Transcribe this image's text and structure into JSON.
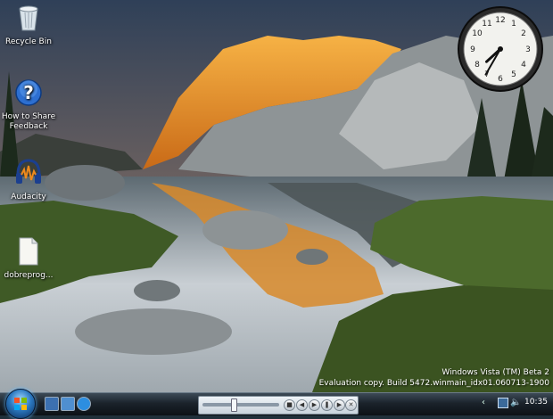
{
  "desktop": {
    "icons": [
      {
        "label": "Recycle Bin"
      },
      {
        "label": "How to Share Feedback"
      },
      {
        "label": "Audacity"
      },
      {
        "label": "dobreprog..."
      }
    ]
  },
  "watermark": {
    "line1": "Windows Vista (TM) Beta 2",
    "line2": "Evaluation copy. Build 5472.winmain_idx01.060713-1900"
  },
  "clock": {
    "hour": 7,
    "minute": 35
  },
  "taskbar": {
    "time": "10:35",
    "tray_arrow": "‹",
    "media_progress": 0.4
  },
  "colors": {
    "taskbar": "#1b232b",
    "start_orb": "#2b78c0"
  }
}
